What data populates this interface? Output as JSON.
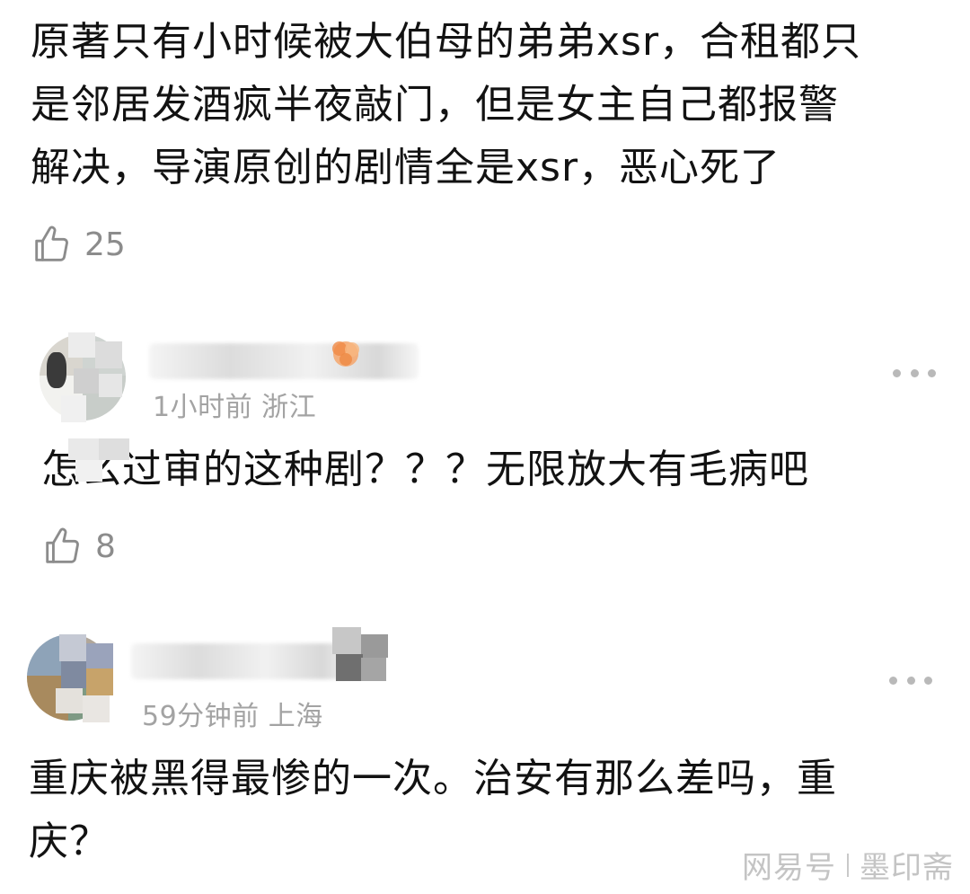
{
  "comments": [
    {
      "text": "原著只有小时候被大伯母的弟弟xsr，合租都只\n是邻居发酒疯半夜敲门，但是女主自己都报警\n解决，导演原创的剧情全是xsr，恶心死了",
      "likes": "25"
    },
    {
      "meta": "1小时前 浙江",
      "text": "怎么过审的这种剧？？？无限放大有毛病吧",
      "likes": "8"
    },
    {
      "meta": "59分钟前 上海",
      "text": "重庆被黑得最惨的一次。治安有那么差吗，重\n庆？"
    }
  ],
  "watermark": {
    "source": "网易号",
    "author": "墨印斋"
  },
  "icons": [
    "thumbs-up-icon",
    "more-icon"
  ]
}
